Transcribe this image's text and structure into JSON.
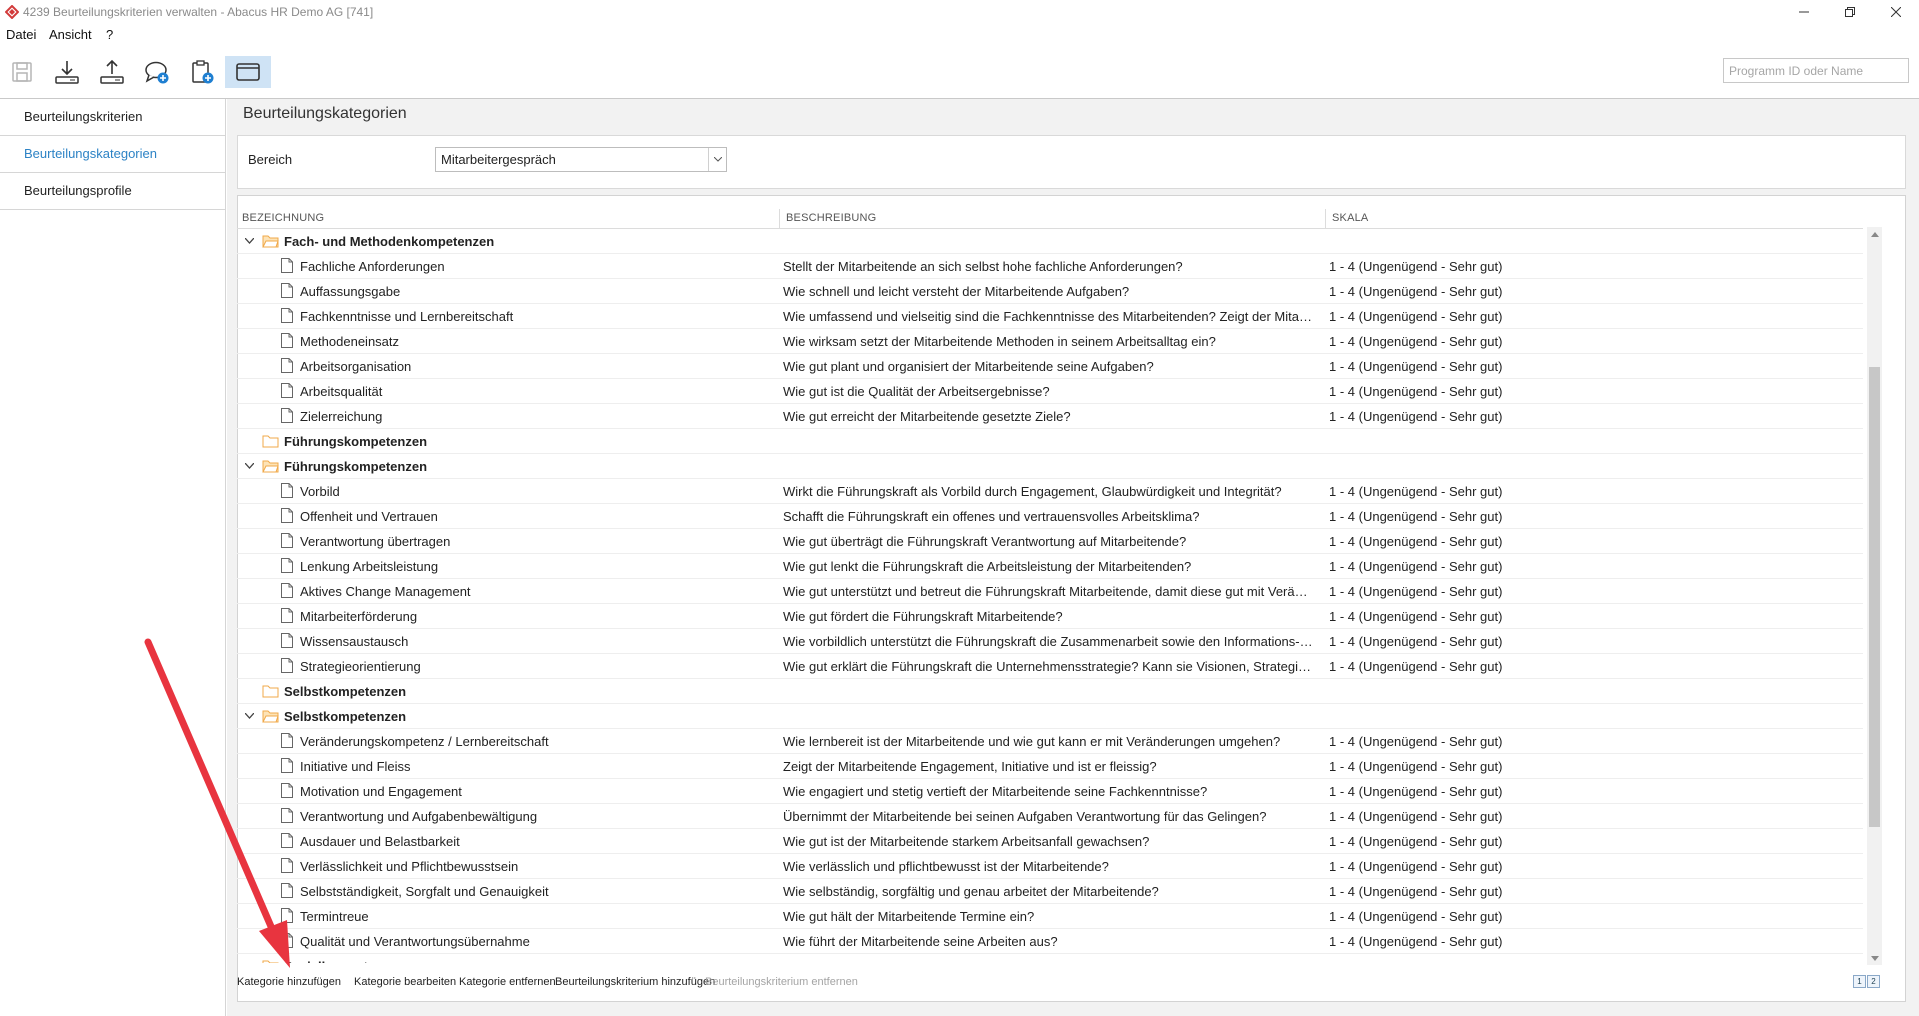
{
  "window": {
    "title": "4239 Beurteilungskriterien verwalten - Abacus HR Demo AG [741]",
    "controls": [
      "minimize-icon",
      "restore-icon",
      "close-icon"
    ]
  },
  "menu": {
    "items": [
      "Datei",
      "Ansicht",
      "?"
    ]
  },
  "toolbar": {
    "icons": [
      "save-icon",
      "download-icon",
      "upload-icon",
      "chat-add-icon",
      "clipboard-add-icon",
      "window-icon"
    ]
  },
  "search": {
    "placeholder": "Programm ID oder Name"
  },
  "sidebar": {
    "items": [
      {
        "label": "Beurteilungskriterien",
        "selected": false
      },
      {
        "label": "Beurteilungskategorien",
        "selected": true
      },
      {
        "label": "Beurteilungsprofile",
        "selected": false
      }
    ]
  },
  "main": {
    "title": "Beurteilungskategorien",
    "bereich": {
      "label": "Bereich",
      "value": "Mitarbeitergespräch"
    },
    "columns": [
      "BEZEICHNUNG",
      "BESCHREIBUNG",
      "SKALA"
    ],
    "rows": [
      {
        "type": "category",
        "expanded": true,
        "name": "Fach- und Methodenkompetenzen",
        "desc": "",
        "scale": ""
      },
      {
        "type": "item",
        "name": "Fachliche Anforderungen",
        "desc": "Stellt der Mitarbeitende an sich selbst hohe fachliche Anforderungen?",
        "scale": "1 - 4 (Ungenügend  - Sehr gut)"
      },
      {
        "type": "item",
        "name": "Auffassungsgabe",
        "desc": "Wie schnell und leicht versteht der Mitarbeitende Aufgaben?",
        "scale": "1 - 4 (Ungenügend  - Sehr gut)"
      },
      {
        "type": "item",
        "name": "Fachkenntnisse und Lernbereitschaft",
        "desc": "Wie umfassend und vielseitig sind die Fachkenntnisse des Mitarbeitenden? Zeigt der Mitarbeitende Lernbereitschaft?",
        "scale": "1 - 4 (Ungenügend  - Sehr gut)"
      },
      {
        "type": "item",
        "name": "Methodeneinsatz",
        "desc": "Wie wirksam setzt der Mitarbeitende Methoden in seinem Arbeitsalltag ein?",
        "scale": "1 - 4 (Ungenügend  - Sehr gut)"
      },
      {
        "type": "item",
        "name": "Arbeitsorganisation",
        "desc": "Wie gut plant und organisiert der Mitarbeitende seine Aufgaben?",
        "scale": "1 - 4 (Ungenügend  - Sehr gut)"
      },
      {
        "type": "item",
        "name": "Arbeitsqualität",
        "desc": "Wie gut ist die Qualität der Arbeitsergebnisse?",
        "scale": "1 - 4 (Ungenügend  - Sehr gut)"
      },
      {
        "type": "item",
        "name": "Zielerreichung",
        "desc": "Wie gut erreicht der Mitarbeitende gesetzte Ziele?",
        "scale": "1 - 4 (Ungenügend  - Sehr gut)"
      },
      {
        "type": "category",
        "expanded": false,
        "name": "Führungskompetenzen",
        "desc": "",
        "scale": ""
      },
      {
        "type": "category",
        "expanded": true,
        "name": "Führungskompetenzen",
        "desc": "",
        "scale": ""
      },
      {
        "type": "item",
        "name": "Vorbild",
        "desc": "Wirkt die Führungskraft als Vorbild durch Engagement, Glaubwürdigkeit und Integrität?",
        "scale": "1 - 4 (Ungenügend  - Sehr gut)"
      },
      {
        "type": "item",
        "name": "Offenheit und Vertrauen",
        "desc": "Schafft die Führungskraft ein offenes und vertrauensvolles Arbeitsklima?",
        "scale": "1 - 4 (Ungenügend  - Sehr gut)"
      },
      {
        "type": "item",
        "name": "Verantwortung übertragen",
        "desc": "Wie gut überträgt die Führungskraft Verantwortung auf Mitarbeitende?",
        "scale": "1 - 4 (Ungenügend  - Sehr gut)"
      },
      {
        "type": "item",
        "name": "Lenkung Arbeitsleistung",
        "desc": "Wie gut lenkt die Führungskraft die Arbeitsleistung der Mitarbeitenden?",
        "scale": "1 - 4 (Ungenügend  - Sehr gut)"
      },
      {
        "type": "item",
        "name": "Aktives Change Management",
        "desc": "Wie gut unterstützt und betreut die Führungskraft Mitarbeitende, damit diese gut mit Veränderungen umgehen können?",
        "scale": "1 - 4 (Ungenügend  - Sehr gut)"
      },
      {
        "type": "item",
        "name": "Mitarbeiterförderung",
        "desc": "Wie gut fördert die Führungskraft Mitarbeitende?",
        "scale": "1 - 4 (Ungenügend  - Sehr gut)"
      },
      {
        "type": "item",
        "name": "Wissensaustausch",
        "desc": "Wie vorbildlich unterstützt die Führungskraft die Zusammenarbeit sowie den Informations- und Wissensaustausch?",
        "scale": "1 - 4 (Ungenügend  - Sehr gut)"
      },
      {
        "type": "item",
        "name": "Strategieorientierung",
        "desc": "Wie gut erklärt die Führungskraft die Unternehmensstrategie? Kann sie Visionen, Strategien und Ziele vermitteln?",
        "scale": "1 - 4 (Ungenügend  - Sehr gut)"
      },
      {
        "type": "category",
        "expanded": false,
        "name": "Selbstkompetenzen",
        "desc": "",
        "scale": ""
      },
      {
        "type": "category",
        "expanded": true,
        "name": "Selbstkompetenzen",
        "desc": "",
        "scale": ""
      },
      {
        "type": "item",
        "name": "Veränderungskompetenz / Lernbereitschaft",
        "desc": "Wie lernbereit ist der Mitarbeitende und wie gut kann er mit Veränderungen umgehen?",
        "scale": "1 - 4 (Ungenügend  - Sehr gut)"
      },
      {
        "type": "item",
        "name": "Initiative und Fleiss",
        "desc": "Zeigt der Mitarbeitende Engagement, Initiative und ist er fleissig?",
        "scale": "1 - 4 (Ungenügend  - Sehr gut)"
      },
      {
        "type": "item",
        "name": "Motivation und Engagement",
        "desc": "Wie engagiert und stetig vertieft der Mitarbeitende seine Fachkenntnisse?",
        "scale": "1 - 4 (Ungenügend  - Sehr gut)"
      },
      {
        "type": "item",
        "name": "Verantwortung und Aufgabenbewältigung",
        "desc": "Übernimmt der Mitarbeitende bei seinen Aufgaben Verantwortung für das Gelingen?",
        "scale": "1 - 4 (Ungenügend  - Sehr gut)"
      },
      {
        "type": "item",
        "name": "Ausdauer und Belastbarkeit",
        "desc": "Wie gut ist der Mitarbeitende starkem Arbeitsanfall gewachsen?",
        "scale": "1 - 4 (Ungenügend  - Sehr gut)"
      },
      {
        "type": "item",
        "name": "Verlässlichkeit und Pflichtbewusstsein",
        "desc": "Wie verlässlich und pflichtbewusst ist der Mitarbeitende?",
        "scale": "1 - 4 (Ungenügend  - Sehr gut)"
      },
      {
        "type": "item",
        "name": "Selbstständigkeit, Sorgfalt und Genauigkeit",
        "desc": "Wie selbständig, sorgfältig und genau arbeitet der Mitarbeitende?",
        "scale": "1 - 4 (Ungenügend  - Sehr gut)"
      },
      {
        "type": "item",
        "name": "Termintreue",
        "desc": "Wie gut hält der Mitarbeitende Termine ein?",
        "scale": "1 - 4 (Ungenügend  - Sehr gut)"
      },
      {
        "type": "item",
        "name": "Qualität und Verantwortungsübernahme",
        "desc": "Wie führt der Mitarbeitende seine Arbeiten aus?",
        "scale": "1 - 4 (Ungenügend  - Sehr gut)"
      },
      {
        "type": "category",
        "expanded": false,
        "name": "Sozialkompetenzen",
        "desc": "",
        "scale": ""
      }
    ],
    "actions": [
      {
        "label": "Kategorie hinzufügen",
        "enabled": true
      },
      {
        "label": "Kategorie bearbeiten",
        "enabled": true
      },
      {
        "label": "Kategorie entfernen",
        "enabled": true
      },
      {
        "label": "Beurteilungskriterium hinzufügen",
        "enabled": true
      },
      {
        "label": "Beurteilungskriterium entfernen",
        "enabled": false
      }
    ],
    "pager": [
      "1",
      "2"
    ]
  },
  "colors": {
    "accent": "#2d83c5",
    "folder": "#f5b860",
    "annotation_arrow": "#e8343f",
    "toolbar_active": "#cfe3f5"
  }
}
